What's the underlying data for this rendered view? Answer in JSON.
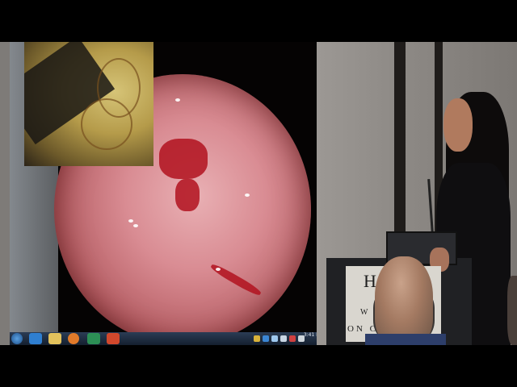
{
  "taskbar": {
    "pinned_icons": [
      "start-orb-icon",
      "internet-explorer-icon",
      "file-explorer-icon",
      "media-player-icon",
      "media-center-icon",
      "powerpoint-icon"
    ],
    "clock_time": "3:41 PM",
    "clock_date": ""
  },
  "podium_sign": {
    "line1": "H",
    "line3": "W",
    "line4": "ON C"
  },
  "colors": {
    "background": "#000000",
    "scope_tissue": "#d98c93",
    "taskbar": "#1f2d42",
    "room_wall": "#8e8a86"
  }
}
